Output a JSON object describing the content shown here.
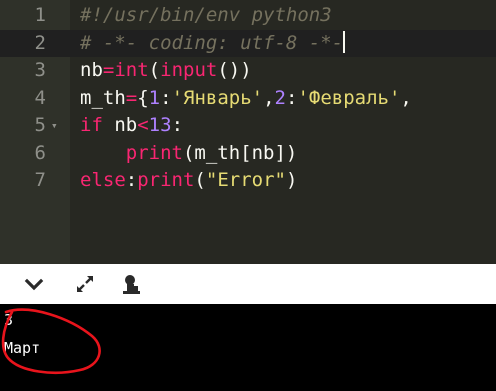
{
  "editor": {
    "lines": [
      {
        "num": "1",
        "tokens": [
          {
            "t": "#!/usr/bin/env python3",
            "c": "comment"
          }
        ]
      },
      {
        "num": "2",
        "active": true,
        "tokens": [
          {
            "t": "# -*- coding: utf-8 -*-",
            "c": "comment"
          }
        ]
      },
      {
        "num": "3",
        "tokens": [
          {
            "t": "nb",
            "c": "id"
          },
          {
            "t": "=",
            "c": "op"
          },
          {
            "t": "int",
            "c": "builtin"
          },
          {
            "t": "(",
            "c": "paren"
          },
          {
            "t": "input",
            "c": "builtin"
          },
          {
            "t": "())",
            "c": "paren"
          }
        ]
      },
      {
        "num": "4",
        "tokens": [
          {
            "t": "m_th",
            "c": "id"
          },
          {
            "t": "=",
            "c": "op"
          },
          {
            "t": "{",
            "c": "paren"
          },
          {
            "t": "1",
            "c": "num"
          },
          {
            "t": ":",
            "c": "paren"
          },
          {
            "t": "'Январь'",
            "c": "str"
          },
          {
            "t": ",",
            "c": "paren"
          },
          {
            "t": "2",
            "c": "num"
          },
          {
            "t": ":",
            "c": "paren"
          },
          {
            "t": "'Февраль'",
            "c": "str"
          },
          {
            "t": ",",
            "c": "paren"
          }
        ]
      },
      {
        "num": "5",
        "fold": "▾",
        "tokens": [
          {
            "t": "if",
            "c": "kw"
          },
          {
            "t": " nb",
            "c": "id"
          },
          {
            "t": "<",
            "c": "op"
          },
          {
            "t": "13",
            "c": "num"
          },
          {
            "t": ":",
            "c": "paren"
          }
        ]
      },
      {
        "num": "6",
        "tokens": [
          {
            "t": "    ",
            "c": "id"
          },
          {
            "t": "print",
            "c": "builtin"
          },
          {
            "t": "(m_th[nb])",
            "c": "paren"
          }
        ]
      },
      {
        "num": "7",
        "tokens": [
          {
            "t": "else",
            "c": "kw"
          },
          {
            "t": ":",
            "c": "paren"
          },
          {
            "t": "print",
            "c": "builtin"
          },
          {
            "t": "(",
            "c": "paren"
          },
          {
            "t": "\"Error\"",
            "c": "str"
          },
          {
            "t": ")",
            "c": "paren"
          }
        ]
      }
    ]
  },
  "toolbar": {
    "icons": [
      "chevron-down-icon",
      "expand-icon",
      "run-icon"
    ]
  },
  "console": {
    "output": [
      "3",
      "Март"
    ]
  },
  "colors": {
    "editor_bg": "#272822",
    "gutter_bg": "#2f3129",
    "annotation": "#e8141c"
  }
}
